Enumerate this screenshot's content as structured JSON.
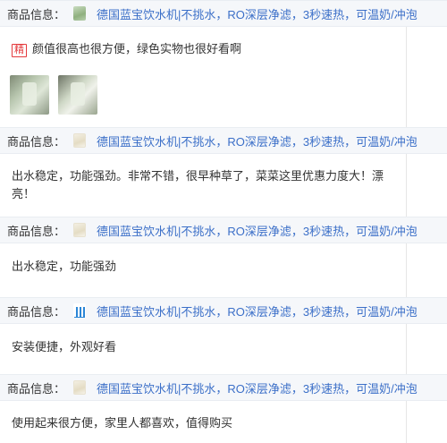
{
  "product_label": "商品信息：",
  "product_name": "德国蓝宝饮水机|不挑水，RO深层净滤，3秒速热，可温奶/冲泡",
  "badge_text": "精",
  "reviews": [
    {
      "thumb_color": "green",
      "text": "颜值很高也很方便，绿色实物也很好看啊"
    },
    {
      "thumb_color": "cream",
      "text": "出水稳定，功能强劲。非常不错，很早种草了，菜菜这里优惠力度大！漂亮！"
    },
    {
      "thumb_color": "cream",
      "text": "出水稳定，功能强劲"
    },
    {
      "thumb_color": "blue",
      "text": "安装便捷，外观好看"
    },
    {
      "thumb_color": "cream",
      "text": "使用起来很方便，家里人都喜欢，值得购买"
    }
  ]
}
